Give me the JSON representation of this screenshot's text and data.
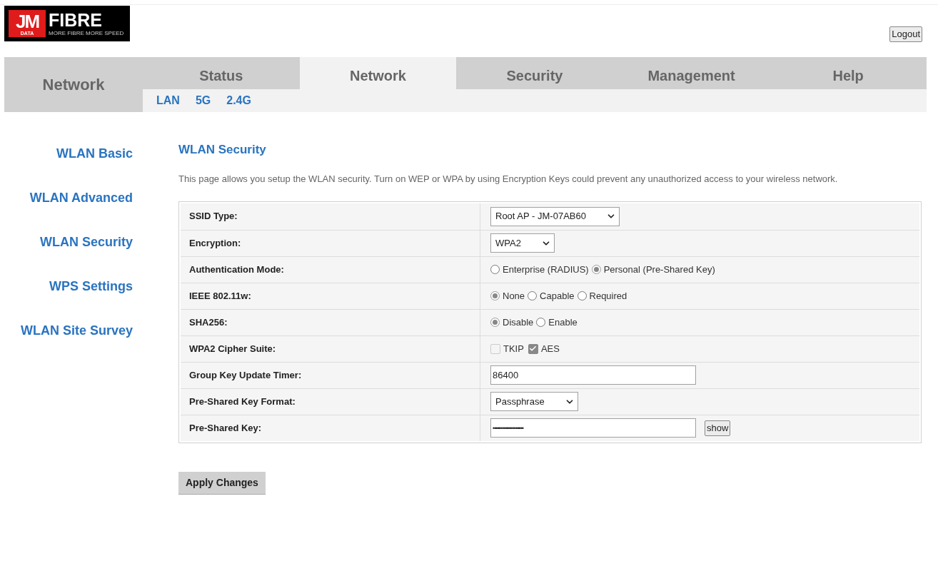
{
  "logo": {
    "mark": "JM",
    "sub": "DATA",
    "name": "FIBRE",
    "tagline": "MORE FIBRE MORE SPEED"
  },
  "logout": "Logout",
  "section_title": "Network",
  "tabs": [
    {
      "label": "Status",
      "selected": false
    },
    {
      "label": "Network",
      "selected": true
    },
    {
      "label": "Security",
      "selected": false
    },
    {
      "label": "Management",
      "selected": false
    },
    {
      "label": "Help",
      "selected": false
    }
  ],
  "subtabs": [
    {
      "label": "LAN",
      "selected": false
    },
    {
      "label": "5G",
      "selected": false
    },
    {
      "label": "2.4G",
      "selected": false
    }
  ],
  "sidebar": {
    "items": [
      {
        "label": "WLAN Basic",
        "selected": false
      },
      {
        "label": "WLAN Advanced",
        "selected": false
      },
      {
        "label": "WLAN Security",
        "selected": false
      },
      {
        "label": "WPS Settings",
        "selected": false
      },
      {
        "label": "WLAN Site Survey",
        "selected": false
      }
    ]
  },
  "page": {
    "title": "WLAN Security",
    "description": "This page allows you setup the WLAN security. Turn on WEP or WPA by using Encryption Keys could prevent any unauthorized access to your wireless network."
  },
  "form": {
    "rows": [
      {
        "label": "SSID Type:",
        "kind": "select",
        "value": "Root AP - JM-07AB60"
      },
      {
        "label": "Encryption:",
        "kind": "select",
        "value": "WPA2"
      },
      {
        "label": "Authentication Mode:",
        "kind": "radio",
        "options": [
          {
            "label": "Enterprise (RADIUS)",
            "selected": false
          },
          {
            "label": "Personal (Pre-Shared Key)",
            "selected": true
          }
        ]
      },
      {
        "label": "IEEE 802.11w:",
        "kind": "radio",
        "options": [
          {
            "label": "None",
            "selected": true
          },
          {
            "label": "Capable",
            "selected": false
          },
          {
            "label": "Required",
            "selected": false
          }
        ]
      },
      {
        "label": "SHA256:",
        "kind": "radio",
        "options": [
          {
            "label": "Disable",
            "selected": true
          },
          {
            "label": "Enable",
            "selected": false
          }
        ]
      },
      {
        "label": "WPA2 Cipher Suite:",
        "kind": "checkbox",
        "options": [
          {
            "label": "TKIP",
            "checked": false,
            "disabled": true
          },
          {
            "label": "AES",
            "checked": true,
            "disabled": true
          }
        ]
      },
      {
        "label": "Group Key Update Timer:",
        "kind": "text",
        "value": "86400"
      },
      {
        "label": "Pre-Shared Key Format:",
        "kind": "select",
        "value": "Passphrase"
      },
      {
        "label": "Pre-Shared Key:",
        "kind": "password",
        "value": "••••••••••••••••••••",
        "button": "show"
      }
    ]
  },
  "apply_button": "Apply Changes"
}
